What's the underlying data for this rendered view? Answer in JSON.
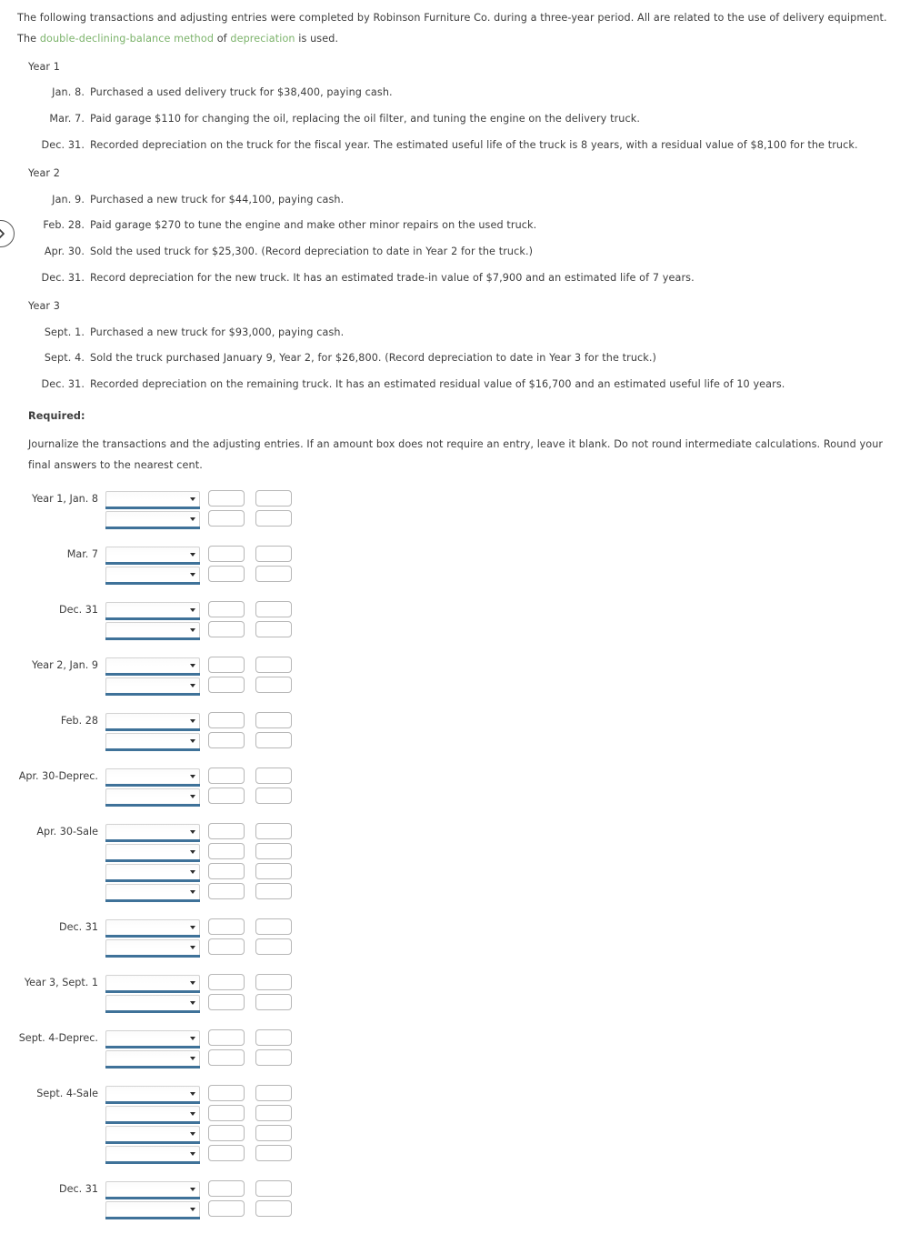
{
  "intro": {
    "part1": "The following transactions and adjusting entries were completed by Robinson Furniture Co. during a three-year period. All are related to the use of delivery equipment. The ",
    "link1": "double-declining-balance method",
    "mid1": " of ",
    "link2": "depreciation",
    "part2": " is used."
  },
  "nav": {
    "next_icon": "chevron-right-icon"
  },
  "years": [
    {
      "heading": "Year 1",
      "transactions": [
        {
          "date": "Jan. 8.",
          "text": "Purchased a used delivery truck for $38,400, paying cash."
        },
        {
          "date": "Mar. 7.",
          "text": "Paid garage $110 for changing the oil, replacing the oil filter, and tuning the engine on the delivery truck."
        },
        {
          "date": "Dec. 31.",
          "text": "Recorded depreciation on the truck for the fiscal year. The estimated useful life of the truck is 8 years, with a residual value of $8,100 for the truck."
        }
      ]
    },
    {
      "heading": "Year 2",
      "transactions": [
        {
          "date": "Jan. 9.",
          "text": "Purchased a new truck for $44,100, paying cash."
        },
        {
          "date": "Feb. 28.",
          "text": "Paid garage $270 to tune the engine and make other minor repairs on the used truck."
        },
        {
          "date": "Apr. 30.",
          "text": "Sold the used truck for $25,300. (Record depreciation to date in Year 2 for the truck.)"
        },
        {
          "date": "Dec. 31.",
          "text": "Record depreciation for the new truck. It has an estimated trade-in value of $7,900 and an estimated life of 7 years."
        }
      ]
    },
    {
      "heading": "Year 3",
      "transactions": [
        {
          "date": "Sept. 1.",
          "text": "Purchased a new truck for $93,000, paying cash."
        },
        {
          "date": "Sept. 4.",
          "text": "Sold the truck purchased January 9, Year 2, for $26,800. (Record depreciation to date in Year 3 for the truck.)"
        },
        {
          "date": "Dec. 31.",
          "text": "Recorded depreciation on the remaining truck. It has an estimated residual value of $16,700 and an estimated useful life of 10 years."
        }
      ]
    }
  ],
  "required": {
    "heading": "Required:",
    "instructions": "Journalize the transactions and the adjusting entries. If an amount box does not require an entry, leave it blank. Do not round intermediate calculations. Round your final answers to the nearest cent."
  },
  "journal": {
    "select_value": "",
    "debit_value": "",
    "credit_value": "",
    "groups": [
      {
        "label": "Year 1, Jan. 8",
        "rows": 2
      },
      {
        "label": "Mar. 7",
        "rows": 2
      },
      {
        "label": "Dec. 31",
        "rows": 2
      },
      {
        "label": "Year 2, Jan. 9",
        "rows": 2
      },
      {
        "label": "Feb. 28",
        "rows": 2
      },
      {
        "label": "Apr. 30-Deprec.",
        "rows": 2
      },
      {
        "label": "Apr. 30-Sale",
        "rows": 4
      },
      {
        "label": "Dec. 31",
        "rows": 2
      },
      {
        "label": "Year 3, Sept. 1",
        "rows": 2
      },
      {
        "label": "Sept. 4-Deprec.",
        "rows": 2
      },
      {
        "label": "Sept. 4-Sale",
        "rows": 4
      },
      {
        "label": "Dec. 31",
        "rows": 2
      }
    ]
  },
  "colors": {
    "link_green": "#7cb36b",
    "select_underline": "#3f7299",
    "box_border": "#b7b7b7",
    "text": "#3d3d3d"
  }
}
